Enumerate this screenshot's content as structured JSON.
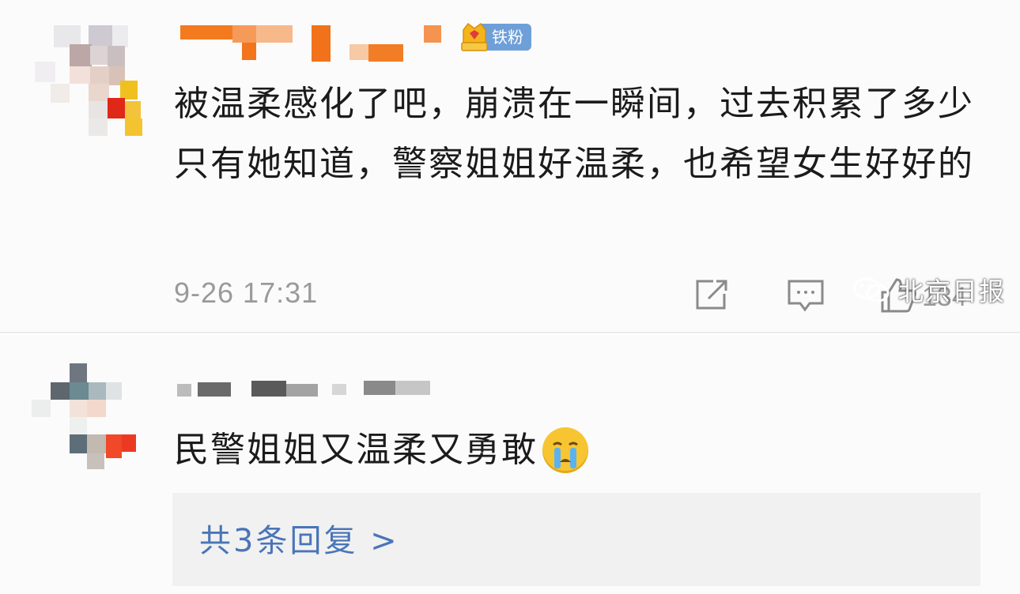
{
  "comments": [
    {
      "badge_label": "铁粉",
      "text": "被温柔感化了吧，崩溃在一瞬间，过去积累了多少只有她知道，警察姐姐好温柔，也希望女生好好的",
      "timestamp": "9-26 17:31",
      "like_count": "134",
      "icons": {
        "share": "share-icon",
        "comment": "comment-icon",
        "like": "thumbs-up-icon"
      }
    },
    {
      "text": "民警姐姐又温柔又勇敢",
      "emoji": "crying-face-emoji",
      "replies_label": "共3条回复 >"
    }
  ],
  "watermark": {
    "label": "北京日报",
    "icon": "wechat-icon"
  },
  "colors": {
    "badge": "#6f9fd8",
    "link": "#4a75b8",
    "username": "#f07c1e"
  }
}
